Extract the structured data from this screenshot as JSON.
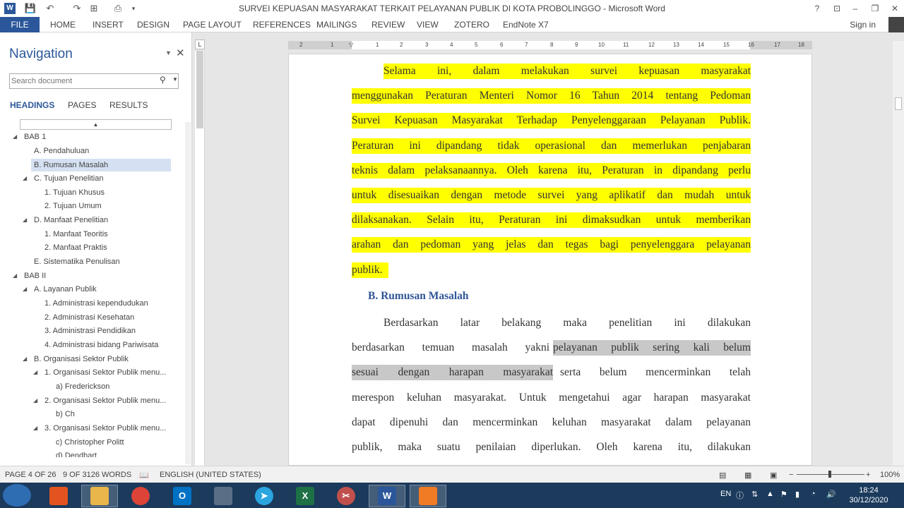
{
  "window": {
    "title": "SURVEI KEPUASAN MASYARAKAT TERKAIT PELAYANAN PUBLIK DI KOTA PROBOLINGGO - Microsoft Word",
    "help": "?",
    "minimize": "–",
    "maximize": "❐",
    "close": "✕"
  },
  "quick_access": {
    "save": "💾",
    "undo": "↶",
    "redo": "↷"
  },
  "ribbon": {
    "file": "FILE",
    "tabs": [
      "HOME",
      "INSERT",
      "DESIGN",
      "PAGE LAYOUT",
      "REFERENCES",
      "MAILINGS",
      "REVIEW",
      "VIEW",
      "ZOTERO",
      "EndNote X7"
    ],
    "sign_in": "Sign in"
  },
  "navigation": {
    "title": "Navigation",
    "search_placeholder": "Search document",
    "tabs": [
      "HEADINGS",
      "PAGES",
      "RESULTS"
    ],
    "active_tab": "HEADINGS",
    "headings": [
      {
        "label": "BAB 1",
        "arrow": "◢"
      },
      {
        "label": "A. Pendahuluan",
        "arrow": ""
      },
      {
        "label": "B. Rumusan Masalah",
        "arrow": "",
        "selected": true
      },
      {
        "label": "C. Tujuan Penelitian",
        "arrow": "◢"
      },
      {
        "label": "1. Tujuan Khusus",
        "arrow": ""
      },
      {
        "label": "2. Tujuan Umum",
        "arrow": ""
      },
      {
        "label": "D. Manfaat Penelitian",
        "arrow": "◢"
      },
      {
        "label": "1. Manfaat Teoritis",
        "arrow": ""
      },
      {
        "label": "2. Manfaat Praktis",
        "arrow": ""
      },
      {
        "label": "E. Sistematika Penulisan",
        "arrow": ""
      },
      {
        "label": "BAB II",
        "arrow": "◢"
      },
      {
        "label": "A. Layanan Publik",
        "arrow": "◢"
      },
      {
        "label": "1. Administrasi kependudukan",
        "arrow": ""
      },
      {
        "label": "2. Administrasi Kesehatan",
        "arrow": ""
      },
      {
        "label": "3. Administrasi Pendidikan",
        "arrow": ""
      },
      {
        "label": "4. Administrasi bidang Pariwisata",
        "arrow": ""
      },
      {
        "label": "B. Organisasi Sektor Publik",
        "arrow": "◢"
      },
      {
        "label": "1. Organisasi Sektor Publik menu...",
        "arrow": "◢"
      },
      {
        "label": "a) Frederickson",
        "arrow": ""
      },
      {
        "label": "2. Organisasi Sektor Publik menu...",
        "arrow": "◢"
      },
      {
        "label": "b) Ch",
        "arrow": ""
      },
      {
        "label": "3. Organisasi Sektor Publik menu...",
        "arrow": "◢"
      },
      {
        "label": "c) Christopher Politt",
        "arrow": ""
      },
      {
        "label": "d) Dendhart",
        "arrow": ""
      }
    ]
  },
  "ruler": {
    "corner": "L",
    "numbers": [
      "2",
      "1",
      "1",
      "2",
      "3",
      "4",
      "5",
      "6",
      "7",
      "8",
      "9",
      "10",
      "11",
      "12",
      "13",
      "14",
      "15",
      "16",
      "17",
      "18"
    ]
  },
  "document": {
    "para1": [
      "Selama ini, dalam melakukan survei kepuasan masyarakat",
      "menggunakan Peraturan Menteri Nomor 16 Tahun 2014 tentang Pedoman",
      "Survei Kepuasan Masyarakat Terhadap Penyelenggaraan Pelayanan Publik.",
      "Peraturan ini dipandang tidak operasional dan memerlukan penjabaran",
      "teknis dalam pelaksanaannya. Oleh karena itu, Peraturan in dipandang perlu",
      "untuk disesuaikan dengan metode survei yang aplikatif dan mudah untuk",
      "dilaksanakan. Selain itu, Peraturan ini dimaksudkan untuk memberikan",
      "arahan dan pedoman yang jelas dan tegas bagi penyelenggara pelayanan",
      "publik."
    ],
    "heading": "B. Rumusan Masalah",
    "para2_line1": "Berdasarkan latar belakang maka penelitian ini dilakukan",
    "para2_line2_plain": "berdasarkan temuan masalah yakni ",
    "para2_line2_gray": "pelayanan publik sering kali belum",
    "para2_line3_gray": "sesuai dengan harapan masyarakat",
    "para2_line3_plain": " serta belum mencerminkan telah",
    "para2_rest": [
      "merespon keluhan masyarakat. Untuk mengetahui agar harapan masyarakat",
      "dapat dipenuhi dan mencerminkan keluhan masyarakat dalam pelayanan",
      "publik, maka suatu penilaian diperlukan. Oleh karena itu, dilakukan"
    ]
  },
  "status": {
    "page": "PAGE 4 OF 26",
    "words": "9 OF 3126 WORDS",
    "language": "ENGLISH (UNITED STATES)",
    "zoom": "100%",
    "zoom_minus": "−",
    "zoom_plus": "+"
  },
  "taskbar": {
    "apps": [
      "Office",
      "Explorer",
      "Chrome",
      "Outlook",
      "App",
      "Telegram",
      "Excel",
      "Snipping",
      "Word",
      "Presenter"
    ],
    "lang": "EN",
    "time": "18:24",
    "date": "30/12/2020"
  }
}
